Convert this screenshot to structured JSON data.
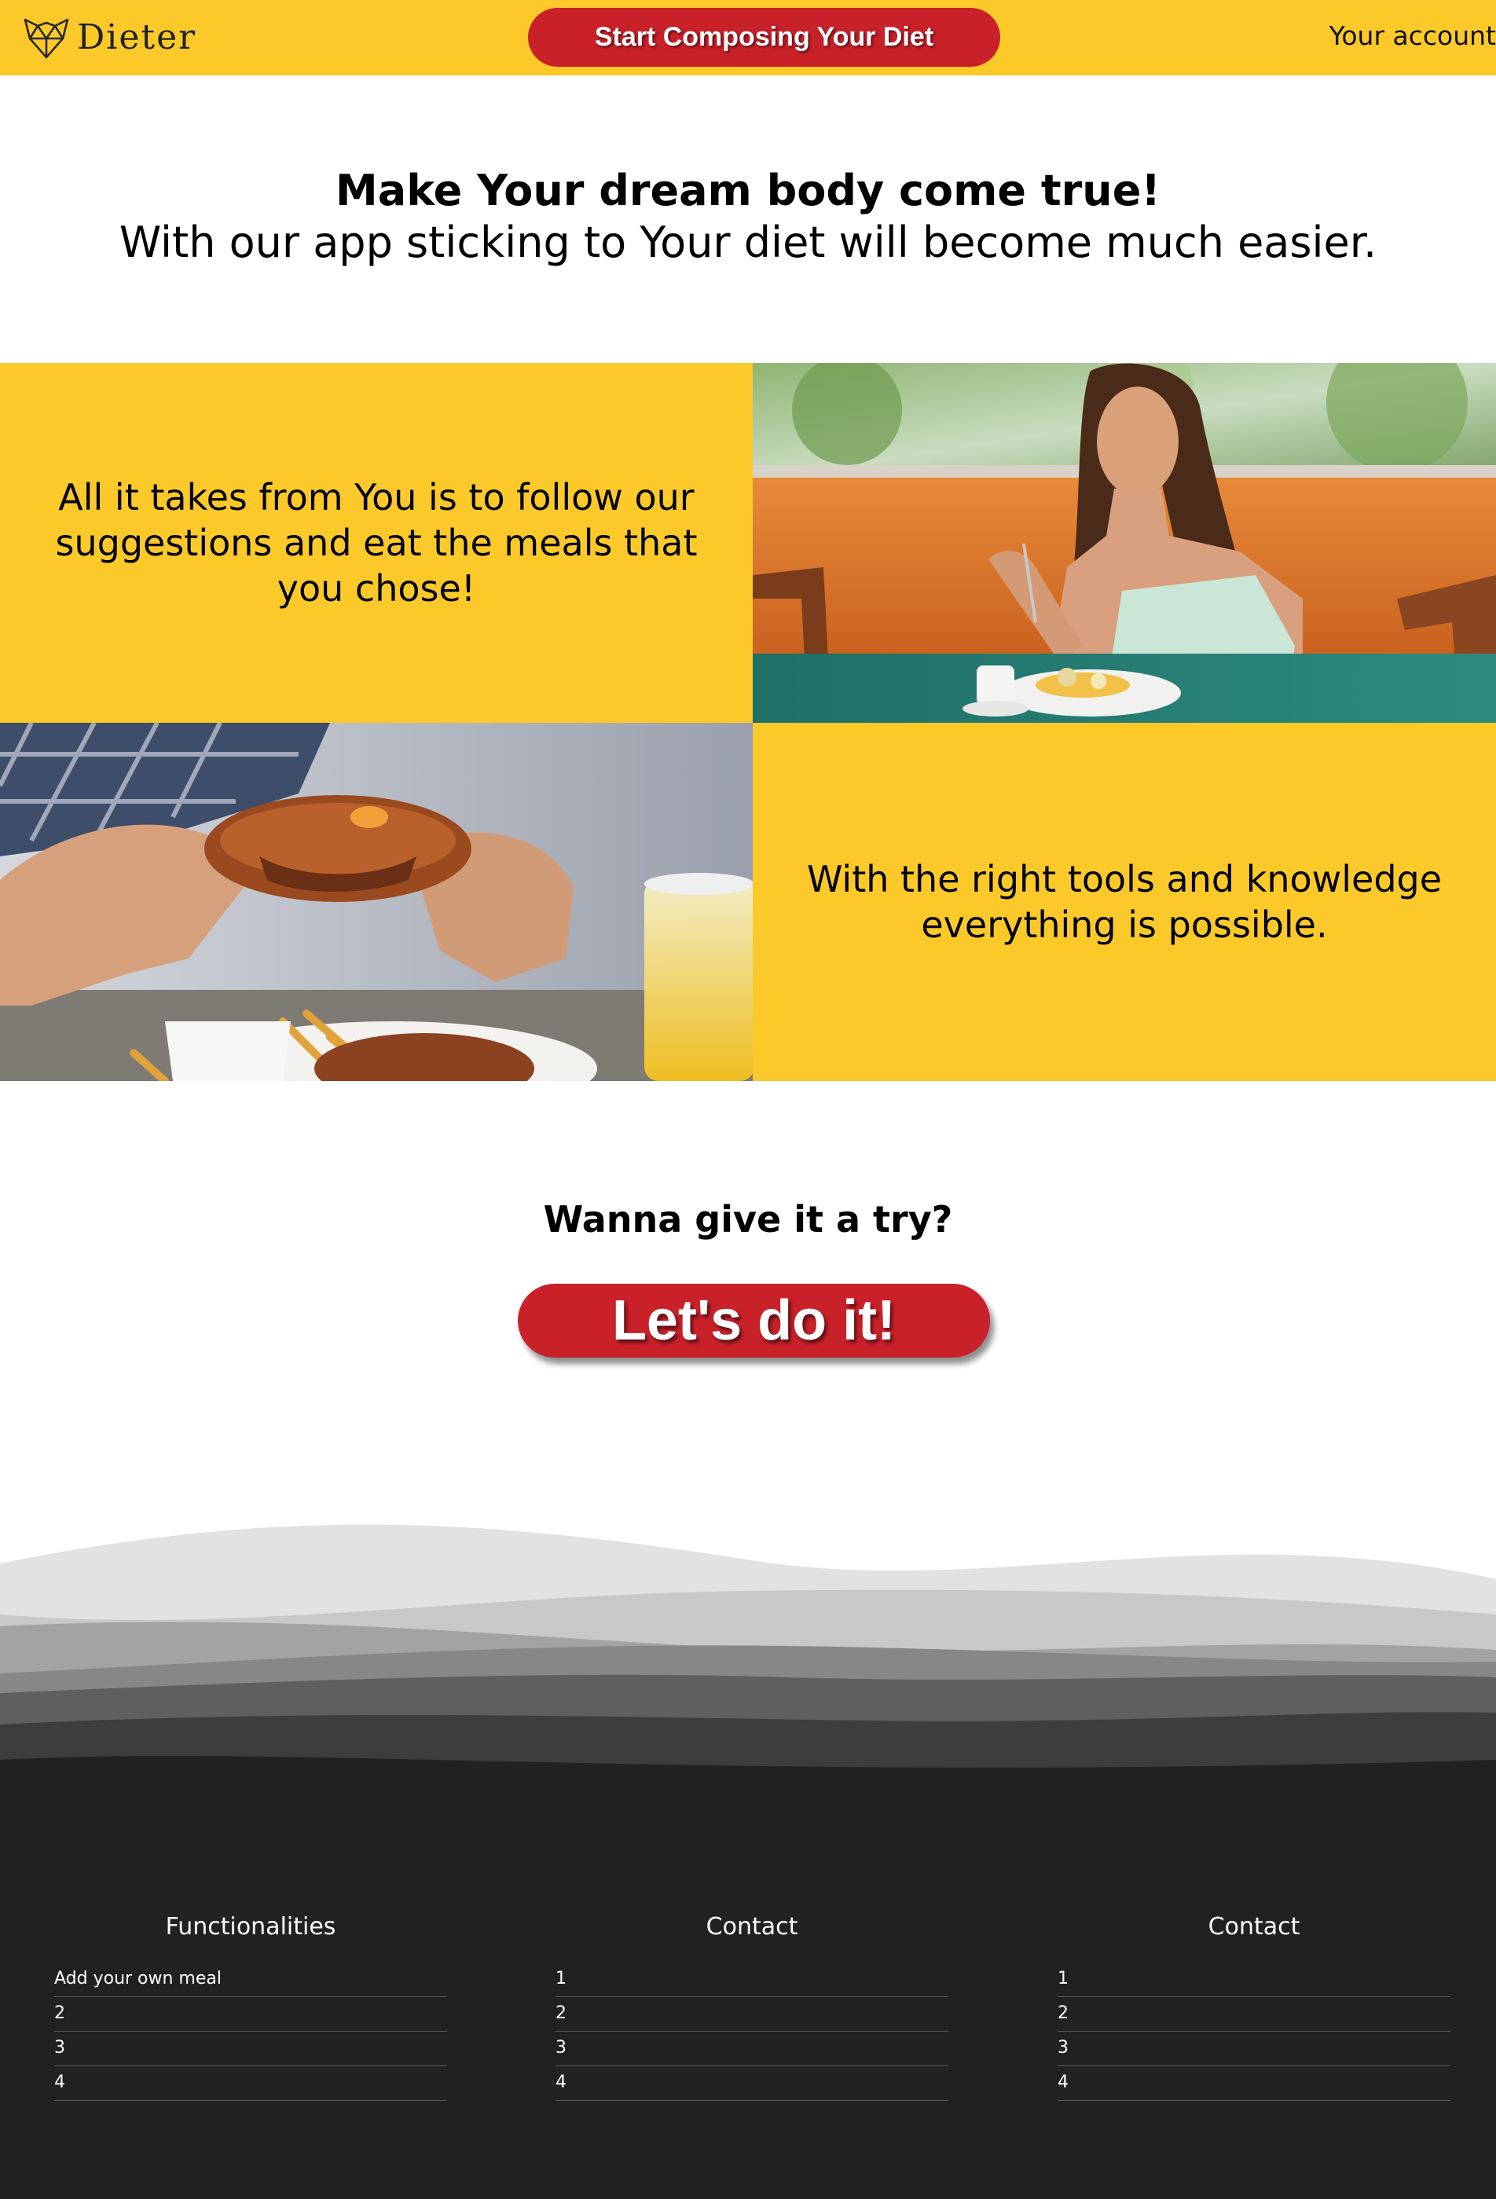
{
  "header": {
    "brand": "Dieter",
    "cta_label": "Start Composing Your Diet",
    "account_label": "Your account"
  },
  "hero": {
    "title": "Make Your dream body come true!",
    "subtitle": "With our app sticking to Your diet will become much easier."
  },
  "features": [
    {
      "text": "All it takes from You is to follow our suggestions and eat the meals that you chose!"
    },
    {
      "text": "With the right tools and knowledge everything is possible."
    }
  ],
  "cta_section": {
    "title": "Wanna give it a try?",
    "button_label": "Let's do it!"
  },
  "footer": {
    "columns": [
      {
        "title": "Functionalities",
        "items": [
          "Add your own meal",
          "2",
          "3",
          "4"
        ]
      },
      {
        "title": "Contact",
        "items": [
          "1",
          "2",
          "3",
          "4"
        ]
      },
      {
        "title": "Contact",
        "items": [
          "1",
          "2",
          "3",
          "4"
        ]
      }
    ]
  },
  "colors": {
    "brand_yellow": "#fcc92b",
    "cta_red": "#c9212a",
    "footer_bg": "#212121"
  }
}
